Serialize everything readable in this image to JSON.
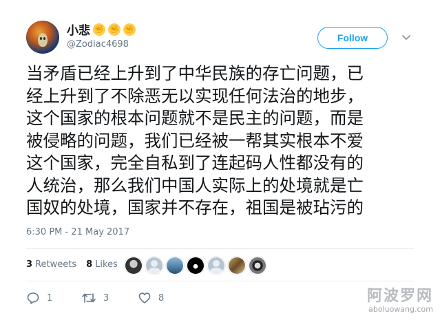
{
  "user": {
    "display_name": "小悲",
    "name_emojis": [
      "✊",
      "✊",
      "✊"
    ],
    "handle": "@Zodiac4698"
  },
  "header": {
    "follow_label": "Follow",
    "accent_color": "#1da1f2"
  },
  "tweet": {
    "lines": [
      "当矛盾已经上升到了中华民族的存亡问题，已",
      "经上升到了不除恶无以实现任何法治的地步，",
      "这个国家的根本问题就不是民主的问题，而是",
      "被侵略的问题，我们已经被一帮其实根本不爱",
      "这个国家，完全自私到了连起码人性都没有的",
      "人统治，那么我们中国人实际上的处境就是亡",
      "国奴的处境，国家并不存在，祖国是被玷污的"
    ],
    "timestamp": "6:30 PM - 21 May 2017"
  },
  "stats": {
    "retweets_count": "3",
    "retweets_label": "Retweets",
    "likes_count": "8",
    "likes_label": "Likes"
  },
  "likers": [
    "liker-avatar-1",
    "liker-avatar-2",
    "liker-avatar-3",
    "liker-avatar-4",
    "liker-avatar-5",
    "liker-avatar-6",
    "liker-avatar-7"
  ],
  "actions": {
    "reply_count": "1",
    "retweet_count": "3",
    "like_count": "8"
  },
  "watermark": {
    "title": "阿波罗网",
    "url": "aboluowang.com"
  },
  "icons": {
    "reply": "reply-icon",
    "retweet": "retweet-icon",
    "like": "heart-icon",
    "caret": "chevron-down-icon"
  }
}
